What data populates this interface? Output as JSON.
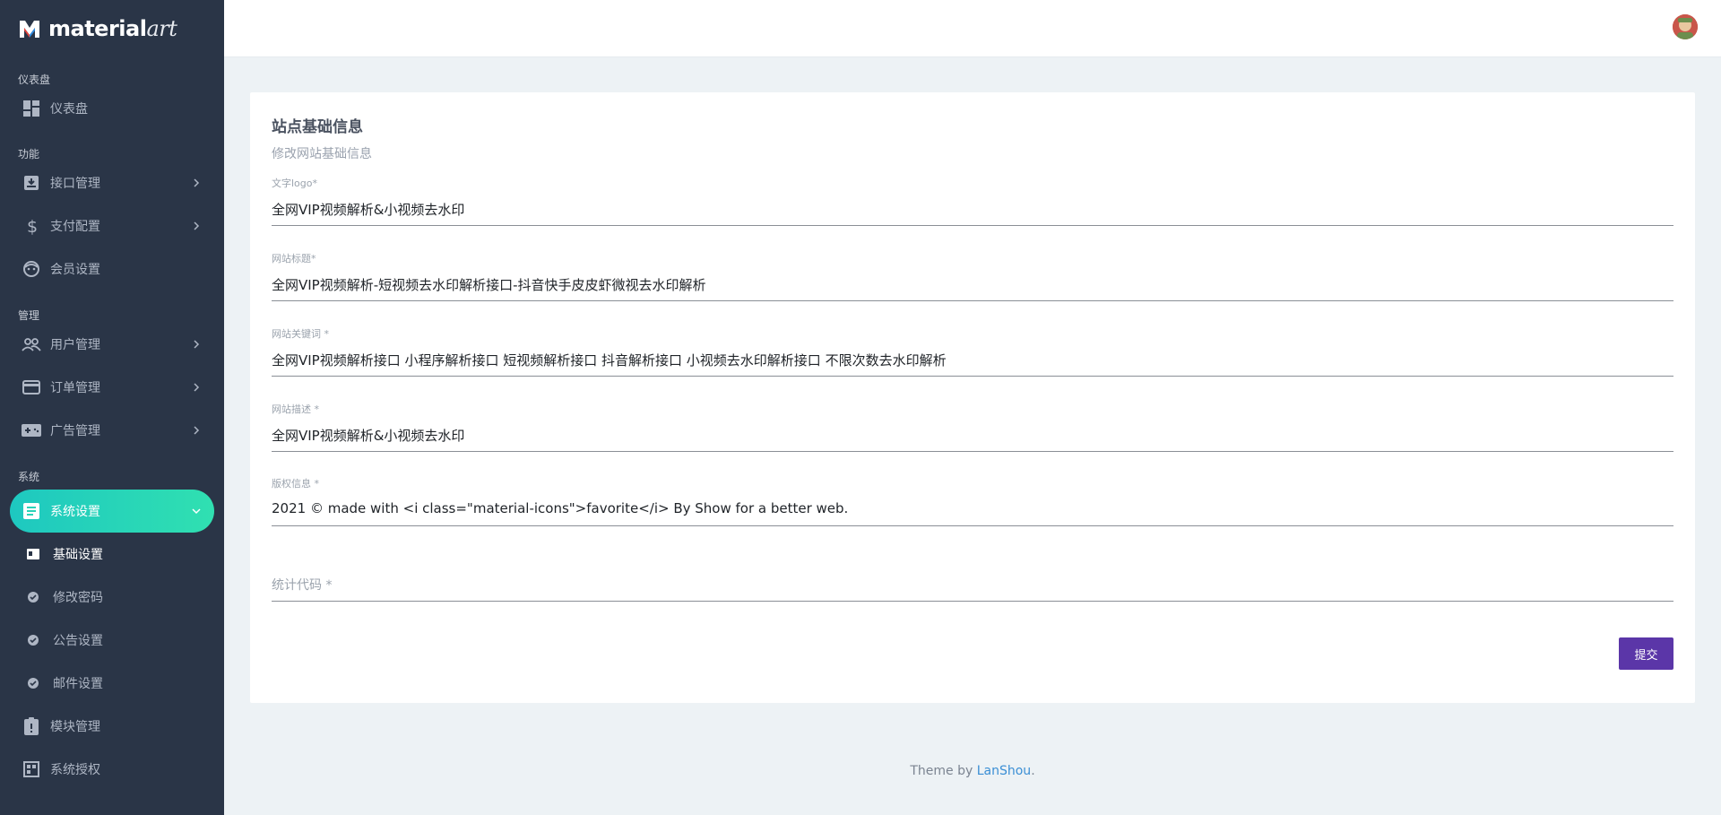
{
  "brand": {
    "name_main": "material",
    "name_accent": "art"
  },
  "sidebar": {
    "sections": [
      {
        "label": "仪表盘"
      },
      {
        "label": "功能"
      },
      {
        "label": "管理"
      },
      {
        "label": "系统"
      }
    ],
    "items": [
      {
        "label": "仪表盘",
        "icon": "dashboard-icon"
      },
      {
        "label": "接口管理",
        "icon": "inbox-icon"
      },
      {
        "label": "支付配置",
        "icon": "dollar-icon"
      },
      {
        "label": "会员设置",
        "icon": "face-icon"
      },
      {
        "label": "用户管理",
        "icon": "people-icon"
      },
      {
        "label": "订单管理",
        "icon": "credit-card-icon"
      },
      {
        "label": "广告管理",
        "icon": "gamepad-icon"
      },
      {
        "label": "系统设置",
        "icon": "list-icon"
      },
      {
        "label": "模块管理",
        "icon": "clipboard-icon"
      },
      {
        "label": "系统授权",
        "icon": "grid-icon"
      }
    ],
    "sub_items": [
      {
        "label": "基础设置"
      },
      {
        "label": "修改密码"
      },
      {
        "label": "公告设置"
      },
      {
        "label": "邮件设置"
      }
    ]
  },
  "card": {
    "title": "站点基础信息",
    "subtitle": "修改网站基础信息",
    "fields": [
      {
        "label": "文字logo*",
        "value": "全网VIP视频解析&小视频去水印"
      },
      {
        "label": "网站标题*",
        "value": "全网VIP视频解析-短视频去水印解析接口-抖音快手皮皮虾微视去水印解析"
      },
      {
        "label": "网站关键词 *",
        "value": "全网VIP视频解析接口 小程序解析接口 短视频解析接口 抖音解析接口 小视频去水印解析接口 不限次数去水印解析"
      },
      {
        "label": "网站描述 *",
        "value": "全网VIP视频解析&小视频去水印"
      },
      {
        "label": "版权信息 *",
        "value": "2021 © made with <i class=\"material-icons\">favorite</i> By Show for a better web."
      },
      {
        "label": "",
        "placeholder": "统计代码 *",
        "value": ""
      }
    ],
    "submit_label": "提交"
  },
  "footer": {
    "prefix": "Theme by ",
    "link": "LanShou",
    "suffix": "."
  },
  "colors": {
    "sidebar_bg": "#2a3547",
    "active_gradient_start": "#1ec8c0",
    "active_gradient_end": "#30e0b1",
    "submit_bg": "#5b36a8",
    "link": "#3b8fd5"
  }
}
